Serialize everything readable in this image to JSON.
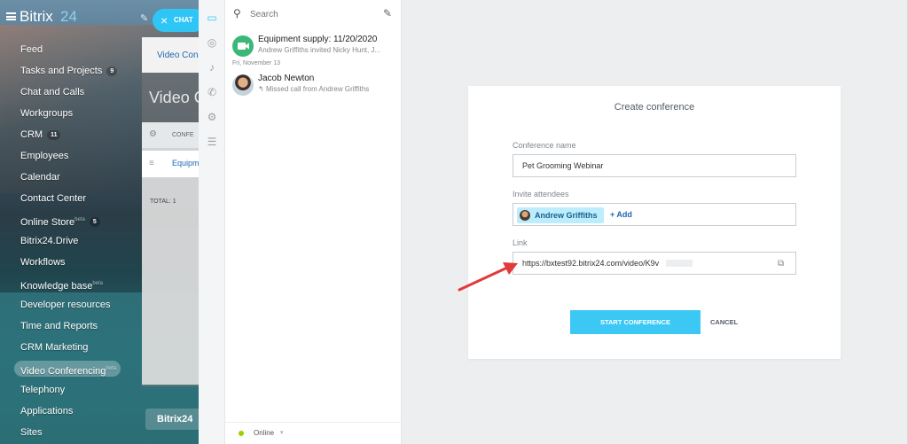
{
  "sidebar": {
    "logo": "Bitrix",
    "logo_suffix": "24",
    "chat_button": "CHAT",
    "items": [
      {
        "label": "Feed",
        "count": "",
        "sup": ""
      },
      {
        "label": "Tasks and Projects",
        "count": "9",
        "sup": ""
      },
      {
        "label": "Chat and Calls",
        "count": "",
        "sup": ""
      },
      {
        "label": "Workgroups",
        "count": "",
        "sup": ""
      },
      {
        "label": "CRM",
        "count": "11",
        "sup": ""
      },
      {
        "label": "Employees",
        "count": "",
        "sup": ""
      },
      {
        "label": "Calendar",
        "count": "",
        "sup": ""
      },
      {
        "label": "Contact Center",
        "count": "",
        "sup": ""
      },
      {
        "label": "Online Store",
        "count": "5",
        "sup": "beta"
      },
      {
        "label": "Bitrix24.Drive",
        "count": "",
        "sup": ""
      },
      {
        "label": "Workflows",
        "count": "",
        "sup": ""
      },
      {
        "label": "Knowledge base",
        "count": "",
        "sup": "beta"
      },
      {
        "label": "Developer resources",
        "count": "",
        "sup": ""
      },
      {
        "label": "Time and Reports",
        "count": "",
        "sup": ""
      },
      {
        "label": "CRM Marketing",
        "count": "",
        "sup": ""
      },
      {
        "label": "Video Conferencing",
        "count": "",
        "sup": "beta"
      },
      {
        "label": "Telephony",
        "count": "",
        "sup": ""
      },
      {
        "label": "Applications",
        "count": "",
        "sup": ""
      },
      {
        "label": "Sites",
        "count": "",
        "sup": ""
      }
    ],
    "active_item": "Video Conferencing",
    "bottom_button": "Bitrix24"
  },
  "background_page": {
    "card_label": "Video Con",
    "title": "Video C",
    "table_header": "CONFE",
    "row_label": "Equipm",
    "total_label": "TOTAL: 1"
  },
  "messenger": {
    "search_placeholder": "Search",
    "chats": [
      {
        "name": "Equipment supply: 11/20/2020",
        "subtitle": "Andrew Griffiths invited Nicky Hunt, J...",
        "avatar_color": "#3bb878"
      },
      {
        "name": "Jacob Newton",
        "subtitle": "Missed call from Andrew Griffiths",
        "avatar_color": "#c7d3dc"
      }
    ],
    "date_label": "Fri, November 13",
    "status": "Online",
    "status_color": "#9dcf00"
  },
  "dialog": {
    "title": "Create conference",
    "name_label": "Conference name",
    "name_value": "Pet Grooming Webinar",
    "attendees_label": "Invite attendees",
    "attendee": "Andrew Griffiths",
    "add_label": "+ Add",
    "link_label": "Link",
    "link_value": "https://bxtest92.bitrix24.com/video/K9v",
    "start_button": "START CONFERENCE",
    "cancel_button": "CANCEL",
    "accent_color": "#3bc8f5"
  }
}
